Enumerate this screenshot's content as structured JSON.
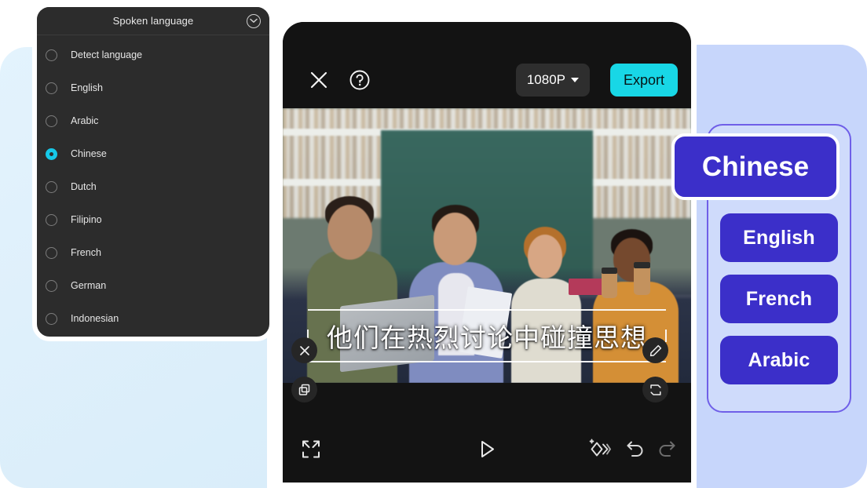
{
  "dropdown": {
    "title": "Spoken language",
    "collapse_icon": "chevron-down-circle-icon",
    "options": [
      {
        "label": "Detect language",
        "selected": false
      },
      {
        "label": "English",
        "selected": false
      },
      {
        "label": "Arabic",
        "selected": false
      },
      {
        "label": "Chinese",
        "selected": true
      },
      {
        "label": "Dutch",
        "selected": false
      },
      {
        "label": "Filipino",
        "selected": false
      },
      {
        "label": "French",
        "selected": false
      },
      {
        "label": "German",
        "selected": false
      },
      {
        "label": "Indonesian",
        "selected": false
      }
    ]
  },
  "editor": {
    "toolbar": {
      "close_icon": "close-icon",
      "help_icon": "help-circle-icon",
      "resolution": "1080P",
      "resolution_caret": "caret-down-icon",
      "export_label": "Export",
      "export_color": "#18d7e6"
    },
    "subtitle": {
      "text": "他们在热烈讨论中碰撞思想",
      "handles": [
        {
          "name": "delete-subtitle-handle",
          "icon": "close-icon"
        },
        {
          "name": "duplicate-subtitle-handle",
          "icon": "copy-icon"
        },
        {
          "name": "edit-subtitle-handle",
          "icon": "pencil-icon"
        },
        {
          "name": "replace-subtitle-handle",
          "icon": "swap-icon"
        }
      ]
    },
    "bottom_bar": [
      {
        "name": "expand-button",
        "icon": "expand-icon"
      },
      {
        "name": "play-button",
        "icon": "play-icon"
      },
      {
        "name": "effects-button",
        "icon": "magic-wand-icon"
      },
      {
        "name": "undo-button",
        "icon": "undo-icon"
      },
      {
        "name": "redo-button",
        "icon": "redo-icon"
      }
    ]
  },
  "language_rail": {
    "active": {
      "label": "Chinese"
    },
    "items": [
      {
        "label": "English"
      },
      {
        "label": "French"
      },
      {
        "label": "Arabic"
      }
    ],
    "button_color": "#3b2fc9",
    "rail_border_color": "#6f5fe8",
    "rail_bg_color": "#cfdbfb"
  },
  "background": {
    "left_color": "#dff0fb",
    "right_color": "#c7d6fb"
  }
}
